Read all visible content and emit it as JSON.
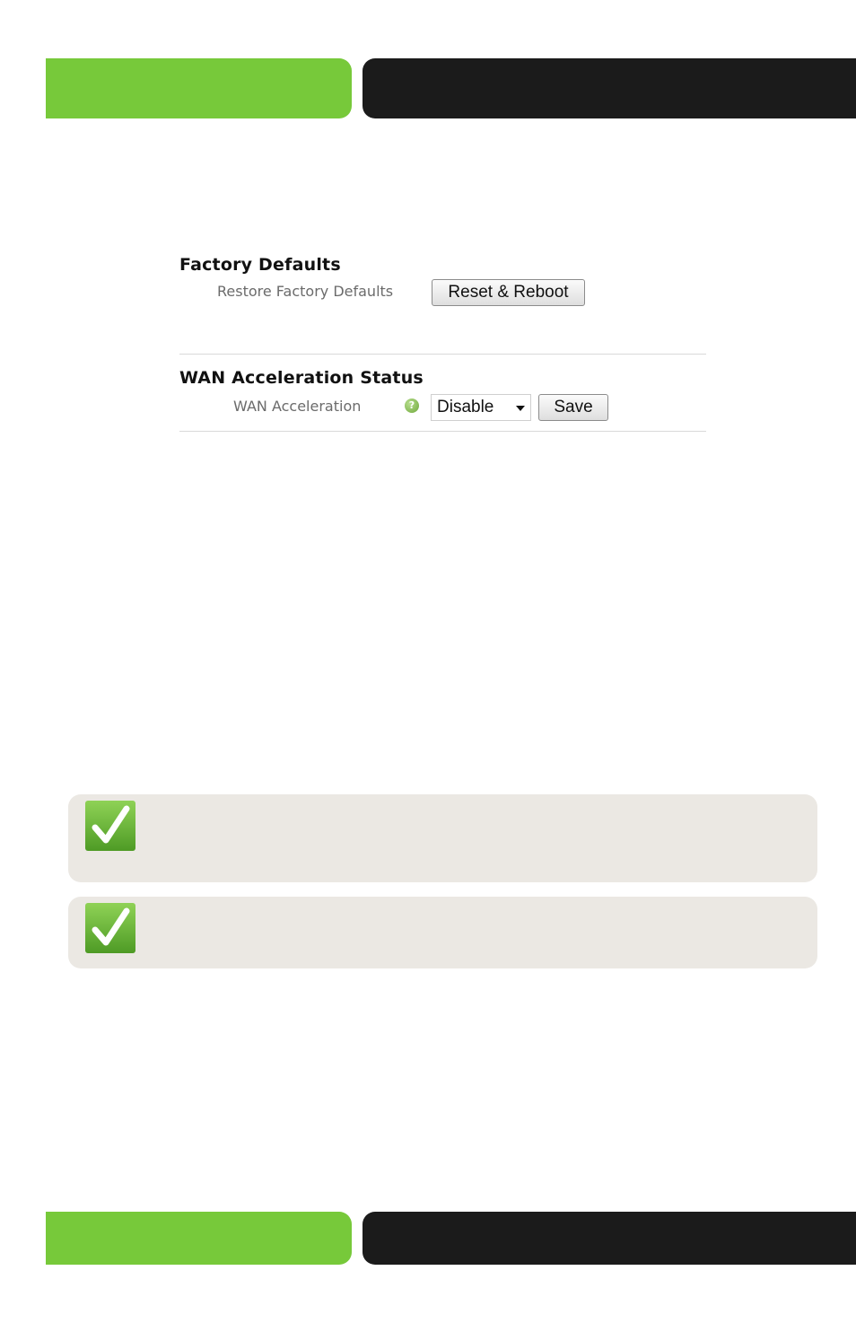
{
  "factory_defaults": {
    "title": "Factory Defaults",
    "restore_label": "Restore Factory Defaults",
    "reset_button": "Reset & Reboot"
  },
  "wan_acceleration": {
    "title": "WAN Acceleration Status",
    "label": "WAN Acceleration",
    "help_icon": "question-mark-icon",
    "selected_option": "Disable",
    "save_button": "Save"
  },
  "notes": [
    {
      "icon": "checkmark-icon"
    },
    {
      "icon": "checkmark-icon"
    }
  ],
  "colors": {
    "accent_green": "#77c93a",
    "bar_black": "#1b1b1b",
    "note_background": "#ebe8e3"
  }
}
